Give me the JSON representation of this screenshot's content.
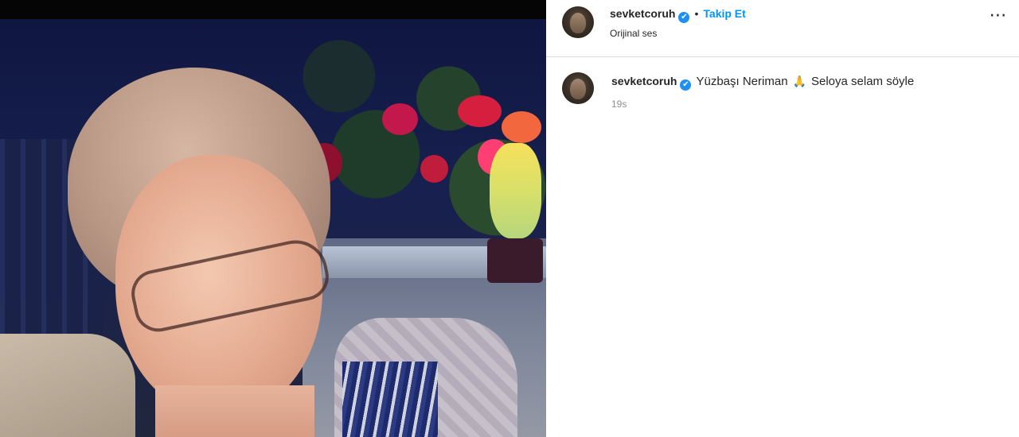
{
  "post": {
    "username": "sevketcoruh",
    "verified_mark": "✔",
    "follow_label": "Takip Et",
    "separator": "•",
    "audio_label": "Orijinal ses",
    "more_icon": "⋯"
  },
  "comments": [
    {
      "username": "sevketcoruh",
      "verified_mark": "✔",
      "caption_part1": "Yüzbaşı Neriman",
      "emoji": "🙏",
      "caption_part2": "Seloya selam söyle",
      "time": "19s"
    }
  ],
  "colors": {
    "follow": "#0095f6",
    "verified": "#1f8ff2",
    "text": "#262626",
    "muted": "#8e8e8e"
  },
  "icons": [
    "verified-badge-icon",
    "more-options-icon",
    "praying-hands-emoji"
  ]
}
